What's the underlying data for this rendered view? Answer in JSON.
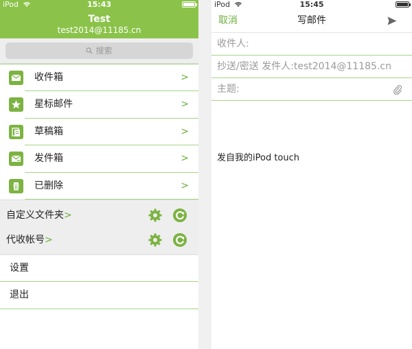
{
  "left_screen": {
    "status_bar": {
      "carrier": "iPod",
      "time": "15:43",
      "battery_level": 0.9
    },
    "account": {
      "name": "Test",
      "email": "test2014@11185.cn"
    },
    "search": {
      "placeholder": "搜索"
    },
    "menu": [
      {
        "label": "收件箱",
        "icon": "inbox-icon",
        "arrow": ">"
      },
      {
        "label": "星标邮件",
        "icon": "star-icon",
        "arrow": ">"
      },
      {
        "label": "草稿箱",
        "icon": "drafts-icon",
        "arrow": ">"
      },
      {
        "label": "发件箱",
        "icon": "outbox-icon",
        "arrow": ">"
      },
      {
        "label": "已删除",
        "icon": "trash-icon",
        "arrow": ">"
      }
    ],
    "folders": [
      {
        "label": "自定义文件夹",
        "arrow": ">"
      },
      {
        "label": "代收帐号",
        "arrow": ">"
      }
    ],
    "settings": [
      {
        "label": "设置"
      },
      {
        "label": "退出"
      }
    ]
  },
  "right_screen": {
    "status_bar": {
      "carrier": "iPod",
      "time": "15:45",
      "battery_level": 0.9
    },
    "nav": {
      "cancel_label": "取消",
      "title": "写邮件",
      "send_icon": "send-icon"
    },
    "fields": {
      "to_label": "收件人:",
      "cc_label": "抄送/密送 发件人:test2014@11185.cn",
      "subject_label": "主题:"
    },
    "signature": "发自我的iPod touch"
  },
  "colors": {
    "accent_green": "#8bc34a",
    "icon_green": "#7cb342",
    "link_green": "#6aaf3d",
    "divider_green": "#a6d585"
  }
}
